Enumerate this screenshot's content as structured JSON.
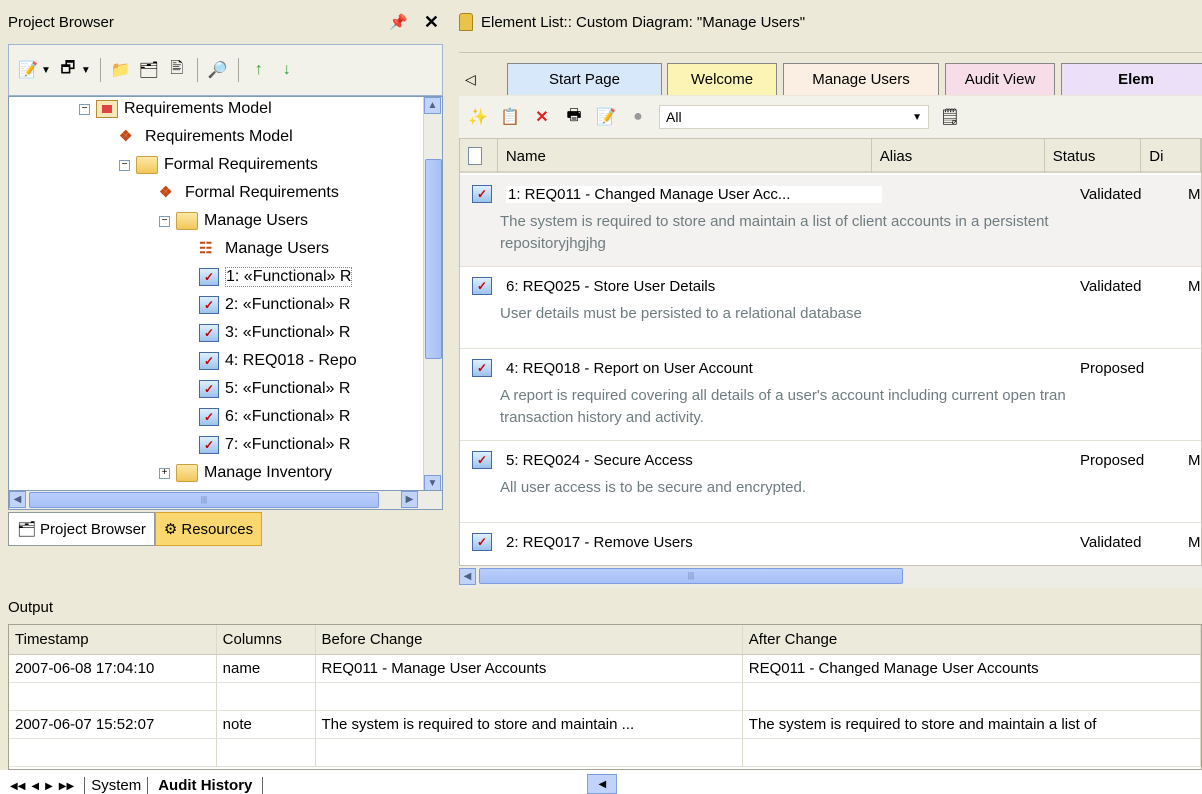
{
  "project_browser": {
    "title": "Project Browser",
    "pin": "ℹ",
    "close": "✕",
    "tree": [
      {
        "label": "Requirements Model",
        "kind": "package",
        "expander": "−"
      },
      {
        "label": "Requirements Model",
        "kind": "diagram"
      },
      {
        "label": "Formal Requirements",
        "kind": "folder",
        "expander": "−"
      },
      {
        "label": "Formal Requirements",
        "kind": "diagram"
      },
      {
        "label": "Manage Users",
        "kind": "folder",
        "expander": "−"
      },
      {
        "label": "Manage Users",
        "kind": "diagram2"
      },
      {
        "label": "1: «Functional» R",
        "kind": "req",
        "selected": true
      },
      {
        "label": "2: «Functional» R",
        "kind": "req"
      },
      {
        "label": "3: «Functional» R",
        "kind": "req"
      },
      {
        "label": "4: REQ018 - Repo",
        "kind": "req"
      },
      {
        "label": "5: «Functional» R",
        "kind": "req"
      },
      {
        "label": "6: «Functional» R",
        "kind": "req"
      },
      {
        "label": "7: «Functional» R",
        "kind": "req"
      },
      {
        "label": "Manage Inventory",
        "kind": "folder",
        "expander": "+"
      }
    ],
    "tabs": {
      "browser": "Project Browser",
      "resources": "Resources"
    }
  },
  "element_list": {
    "title": "Element List:: Custom Diagram: \"Manage Users\"",
    "tabs": [
      "Start Page",
      "Welcome",
      "Manage Users",
      "Audit View",
      "Elem"
    ],
    "filter_value": "All",
    "columns": [
      "Name",
      "Alias",
      "Status",
      "Di"
    ],
    "rows": [
      {
        "name": "1: REQ011 - Changed Manage User Acc...",
        "status": "Validated",
        "extra": "M",
        "note1": "The system is required to store and maintain a list of client accounts in a persistent",
        "note2": "repositoryjhgjhg"
      },
      {
        "name": "6: REQ025 - Store User Details",
        "status": "Validated",
        "extra": "M",
        "note1": "User details must be persisted to a relational database",
        "note2": ""
      },
      {
        "name": "4: REQ018 - Report on User Account",
        "status": "Proposed",
        "extra": "",
        "note1": "A report is required covering all details of a user's account including current open tran",
        "note2": "transaction history and activity."
      },
      {
        "name": "5: REQ024 - Secure Access",
        "status": "Proposed",
        "extra": "M",
        "note1": "All user access is to be secure and encrypted.",
        "note2": ""
      },
      {
        "name": "2: REQ017 - Remove Users",
        "status": "Validated",
        "extra": "M",
        "note1": "",
        "note2": ""
      }
    ]
  },
  "output": {
    "title": "Output",
    "columns": [
      "Timestamp",
      "Columns",
      "Before Change",
      "After Change"
    ],
    "rows": [
      {
        "timestamp": "2007-06-08 17:04:10",
        "column": "name",
        "before": "REQ011 - Manage User Accounts",
        "after": "REQ011 - Changed Manage User Accounts"
      },
      {
        "timestamp": "",
        "column": "",
        "before": "",
        "after": ""
      },
      {
        "timestamp": "2007-06-07 15:52:07",
        "column": "note",
        "before": "The system is required to store and maintain ...",
        "after": "The system is required to store and maintain a list of"
      },
      {
        "timestamp": "",
        "column": "",
        "before": "",
        "after": ""
      }
    ],
    "tabs": [
      "System",
      "Audit History"
    ]
  },
  "colors": {
    "selected_tab": "#fbd86f",
    "welcome_tab": "#fcf4b5",
    "manage_tab": "#fbeee3",
    "audit_tab": "#f7dde8",
    "start_tab": "#d8e8fb",
    "elem_tab": "#ece0f8"
  }
}
